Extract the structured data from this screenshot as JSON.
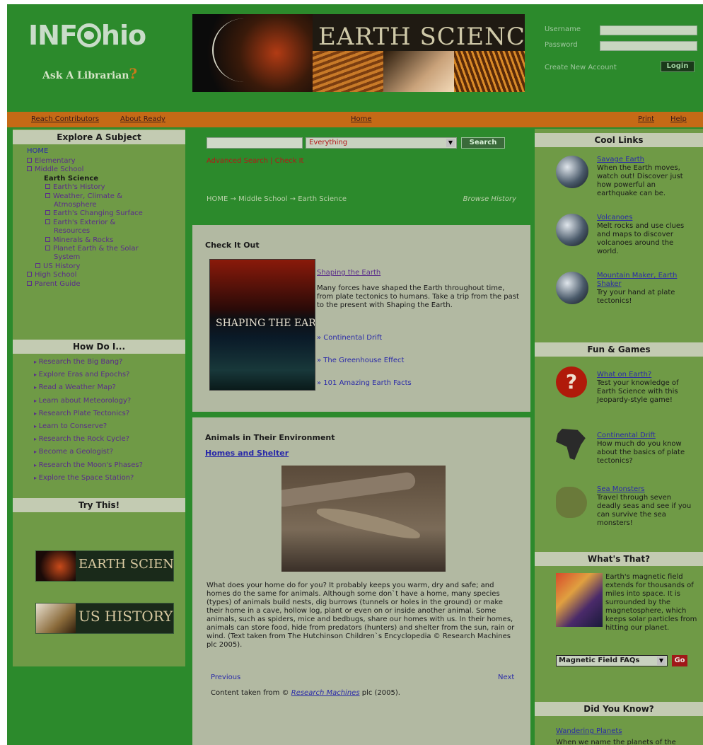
{
  "header": {
    "logo_text": "INFOhio",
    "ask_librarian": "Ask A Librarian",
    "ask_mark": "?",
    "banner_title": "EARTH SCIENCE",
    "username_label": "Username",
    "password_label": "Password",
    "create_account": "Create New Account",
    "login_button": "Login"
  },
  "nav": {
    "left_links": [
      "Reach Contributors",
      "About Ready"
    ],
    "center_text": "Home",
    "right_links": [
      "Print",
      "Help"
    ]
  },
  "explore": {
    "title": "Explore A Subject",
    "home": "HOME",
    "items": [
      {
        "label": "Elementary",
        "level": 1,
        "box": true
      },
      {
        "label": "Middle School",
        "level": 1,
        "box": true
      },
      {
        "label": "Earth Science",
        "level": 2,
        "box": false,
        "active": true
      },
      {
        "label": "Earth's History",
        "level": 3,
        "box": true
      },
      {
        "label": "Weather, Climate &",
        "level": 3,
        "box": true
      },
      {
        "label": "Atmosphere",
        "level": 3,
        "box": false
      },
      {
        "label": "Earth's Changing Surface",
        "level": 3,
        "box": true
      },
      {
        "label": "Earth's Exterior &",
        "level": 3,
        "box": true
      },
      {
        "label": "Resources",
        "level": 3,
        "box": false
      },
      {
        "label": "Minerals & Rocks",
        "level": 3,
        "box": true
      },
      {
        "label": "Planet Earth & the Solar",
        "level": 3,
        "box": true
      },
      {
        "label": "System",
        "level": 3,
        "box": false
      },
      {
        "label": "US History",
        "level": 2,
        "box": true
      },
      {
        "label": "High School",
        "level": 1,
        "box": true
      },
      {
        "label": "Parent Guide",
        "level": 1,
        "box": true
      }
    ]
  },
  "howdo": {
    "title": "How Do I...",
    "items": [
      "Research the Big Bang?",
      "Explore Eras and Epochs?",
      "Read a Weather Map?",
      "Learn about Meteorology?",
      "Research Plate Tectonics?",
      "Learn to Conserve?",
      "Research the Rock Cycle?",
      "Become a Geologist?",
      "Research the Moon's Phases?",
      "Explore the Space Station?"
    ]
  },
  "trythis": {
    "title": "Try This!",
    "items": [
      "EARTH SCIENCE",
      "US HISTORY"
    ]
  },
  "search": {
    "select_value": "Everything",
    "button": "Search",
    "advanced": "Advanced Search | Check It"
  },
  "breadcrumb": "HOME → Middle School → Earth Science",
  "browse_history": "Browse History",
  "check_it_out": {
    "title": "Check It Out",
    "thumb_title": "SHAPING THE EARTH",
    "link": "Shaping the Earth",
    "description": "Many forces have shaped the Earth throughout time, from plate tectonics to humans. Take a trip from the past to the present with Shaping the Earth.",
    "sub_links": [
      "» Continental Drift",
      "» The Greenhouse Effect",
      "» 101 Amazing Earth Facts"
    ]
  },
  "animals": {
    "title": "Animals in Their Environment",
    "subtitle": "Homes and Shelter",
    "body": "What does your home do for you? It probably keeps you warm, dry and safe; and homes do the same for animals. Although some don`t have a home, many species (types) of animals build nests, dig burrows (tunnels or holes in the ground) or make their home in a cave, hollow log, plant or even on or inside another animal. Some animals, such as spiders, mice and bedbugs, share our homes with us. In their homes, animals can store food, hide from predators (hunters) and shelter from the sun, rain or wind. (Text taken from The Hutchinson Children`s Encyclopedia © Research Machines plc 2005).",
    "previous": "Previous",
    "next": "Next",
    "credit_prefix": "Content taken from ©",
    "credit_source": "Research Machines",
    "credit_suffix": "plc (2005)."
  },
  "cool_links": {
    "title": "Cool Links",
    "items": [
      {
        "title": "Savage Earth",
        "text": "When the Earth moves, watch out! Discover just how powerful an earthquake can be."
      },
      {
        "title": "Volcanoes",
        "text": "Melt rocks and use clues and maps to discover volcanoes around the world."
      },
      {
        "title": "Mountain Maker, Earth Shaker",
        "text": "Try your hand at plate tectonics!"
      }
    ]
  },
  "fun_games": {
    "title": "Fun & Games",
    "items": [
      {
        "title": "What on Earth?",
        "text": "Test your knowledge of Earth Science with this Jeopardy-style game!",
        "icon": "question-mark-icon"
      },
      {
        "title": "Continental Drift",
        "text": "How much do you know about the basics of plate tectonics?",
        "icon": "africa-map-icon"
      },
      {
        "title": "Sea Monsters",
        "text": "Travel through seven deadly seas and see if you can survive the sea monsters!",
        "icon": "sea-monster-icon"
      }
    ]
  },
  "whats_that": {
    "title": "What's That?",
    "text": "Earth's magnetic field extends for thousands of miles into space. It is surrounded by the magnetosphere, which keeps solar particles from hitting our planet.",
    "select_value": "Magnetic Field FAQs",
    "go": "Go"
  },
  "did_you_know": {
    "title": "Did You Know?",
    "link": "Wandering Planets",
    "text": "When we name the planets of the"
  }
}
